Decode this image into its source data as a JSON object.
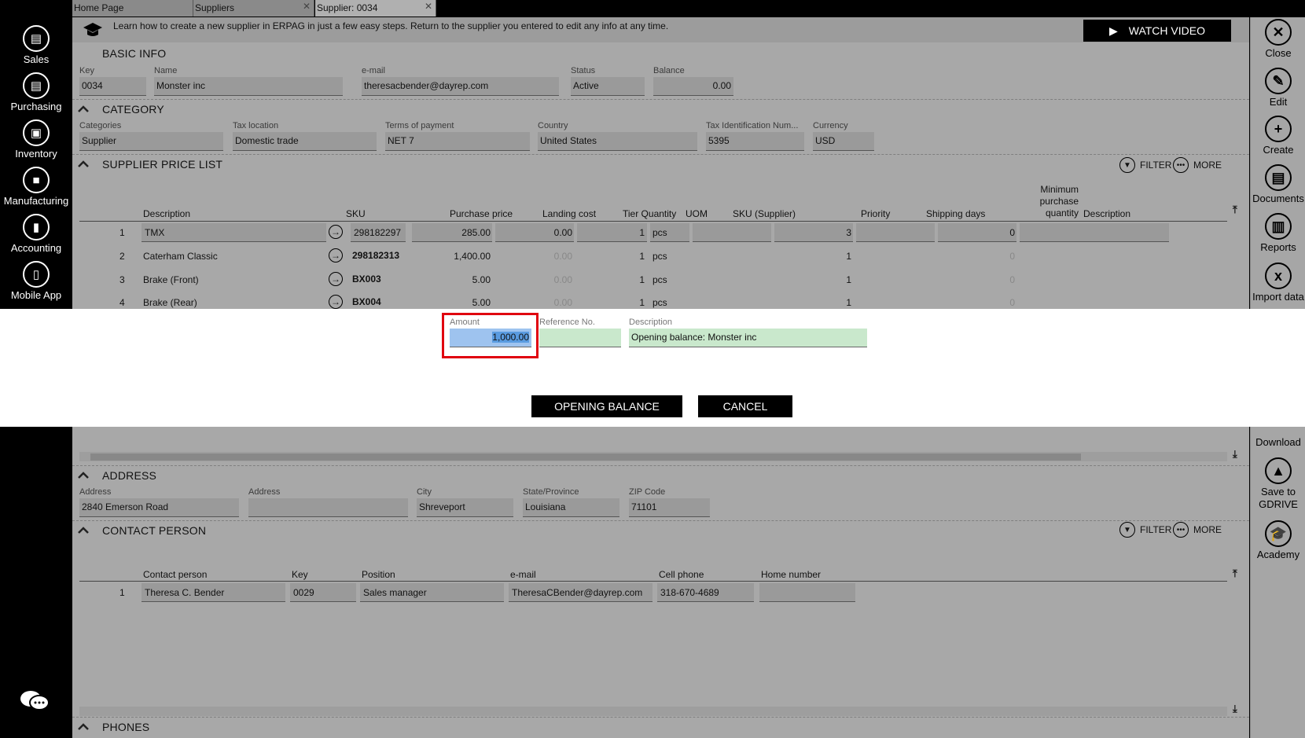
{
  "tabs": [
    {
      "label": "Home Page"
    },
    {
      "label": "Suppliers"
    },
    {
      "label": "Supplier: 0034"
    }
  ],
  "left_nav": [
    {
      "label": "Sales",
      "icon": "sales-icon"
    },
    {
      "label": "Purchasing",
      "icon": "purchasing-icon"
    },
    {
      "label": "Inventory",
      "icon": "inventory-icon"
    },
    {
      "label": "Manufacturing",
      "icon": "manufacturing-icon"
    },
    {
      "label": "Accounting",
      "icon": "accounting-icon"
    },
    {
      "label": "Mobile App",
      "icon": "mobile-app-icon"
    }
  ],
  "right_nav": [
    {
      "label": "Close",
      "icon": "close-icon"
    },
    {
      "label": "Edit",
      "icon": "edit-icon"
    },
    {
      "label": "Create",
      "icon": "create-icon"
    },
    {
      "label": "Documents",
      "icon": "documents-icon"
    },
    {
      "label": "Reports",
      "icon": "reports-icon"
    },
    {
      "label": "Import data",
      "icon": "import-data-icon"
    },
    {
      "label": "Download",
      "icon": "download-icon"
    },
    {
      "label": "Save to GDRIVE",
      "icon": "gdrive-icon"
    },
    {
      "label": "Academy",
      "icon": "academy-icon"
    }
  ],
  "banner": {
    "text": "Learn how to create a new supplier in ERPAG in just a few easy steps. Return to the supplier you entered to edit any info at any time.",
    "watch_label": "WATCH VIDEO"
  },
  "basic_info": {
    "title": "BASIC INFO",
    "fields": [
      {
        "label": "Key",
        "value": "0034"
      },
      {
        "label": "Name",
        "value": "Monster inc"
      },
      {
        "label": "e-mail",
        "value": "theresacbender@dayrep.com"
      },
      {
        "label": "Status",
        "value": "Active"
      },
      {
        "label": "Balance",
        "value": "0.00"
      }
    ]
  },
  "category": {
    "title": "CATEGORY",
    "fields": [
      {
        "label": "Categories",
        "value": "Supplier"
      },
      {
        "label": "Tax location",
        "value": "Domestic trade"
      },
      {
        "label": "Terms of payment",
        "value": "NET 7"
      },
      {
        "label": "Country",
        "value": "United States"
      },
      {
        "label": "Tax Identification Num...",
        "value": "5395"
      },
      {
        "label": "Currency",
        "value": "USD"
      }
    ]
  },
  "price_list": {
    "title": "SUPPLIER PRICE LIST",
    "filter_label": "FILTER",
    "more_label": "MORE",
    "headers": [
      "Description",
      "SKU",
      "Purchase price",
      "Landing cost",
      "Tier Quantity",
      "UOM",
      "SKU (Supplier)",
      "Priority",
      "Shipping days",
      "Minimum purchase quantity",
      "Description"
    ],
    "min_qty_lines": [
      "Minimum",
      "purchase",
      "quantity"
    ],
    "rows": [
      {
        "n": "1",
        "desc": "TMX",
        "sku": "298182297",
        "price": "285.00",
        "landing": "0.00",
        "tier": "1",
        "uom": "pcs",
        "priority": "3",
        "minq": "0"
      },
      {
        "n": "2",
        "desc": "Caterham Classic",
        "sku": "298182313",
        "price": "1,400.00",
        "landing": "0.00",
        "tier": "1",
        "uom": "pcs",
        "priority": "1",
        "minq": "0"
      },
      {
        "n": "3",
        "desc": "Brake (Front)",
        "sku": "BX003",
        "price": "5.00",
        "landing": "0.00",
        "tier": "1",
        "uom": "pcs",
        "priority": "1",
        "minq": "0"
      },
      {
        "n": "4",
        "desc": "Brake (Rear)",
        "sku": "BX004",
        "price": "5.00",
        "landing": "0.00",
        "tier": "1",
        "uom": "pcs",
        "priority": "1",
        "minq": "0"
      }
    ]
  },
  "address": {
    "title": "ADDRESS",
    "fields": [
      {
        "label": "Address",
        "value": "2840 Emerson Road"
      },
      {
        "label": "Address",
        "value": ""
      },
      {
        "label": "City",
        "value": "Shreveport"
      },
      {
        "label": "State/Province",
        "value": "Louisiana"
      },
      {
        "label": "ZIP Code",
        "value": "71101"
      }
    ]
  },
  "contact": {
    "title": "CONTACT PERSON",
    "filter_label": "FILTER",
    "more_label": "MORE",
    "headers": [
      "Contact person",
      "Key",
      "Position",
      "e-mail",
      "Cell phone",
      "Home number"
    ],
    "rows": [
      {
        "n": "1",
        "name": "Theresa C. Bender",
        "key": "0029",
        "position": "Sales manager",
        "email": "TheresaCBender@dayrep.com",
        "cell": "318-670-4689",
        "home": ""
      }
    ]
  },
  "phones": {
    "title": "PHONES"
  },
  "modal": {
    "amount_label": "Amount",
    "amount_value": "1,000.00",
    "ref_label": "Reference No.",
    "ref_value": "",
    "desc_label": "Description",
    "desc_value": "Opening balance: Monster inc",
    "ok_label": "OPENING BALANCE",
    "cancel_label": "CANCEL",
    "highlight_color": "#e0000f"
  }
}
